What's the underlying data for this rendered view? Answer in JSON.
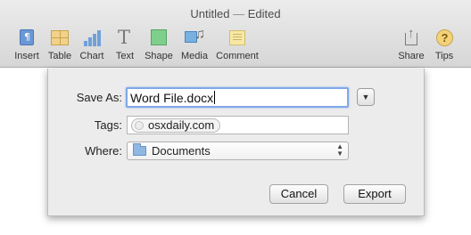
{
  "window": {
    "title_doc": "Untitled",
    "title_sep": "—",
    "title_status": "Edited"
  },
  "toolbar": {
    "items": [
      {
        "label": "Insert",
        "icon": "insert-icon"
      },
      {
        "label": "Table",
        "icon": "table-icon"
      },
      {
        "label": "Chart",
        "icon": "chart-icon"
      },
      {
        "label": "Text",
        "icon": "text-icon"
      },
      {
        "label": "Shape",
        "icon": "shape-icon"
      },
      {
        "label": "Media",
        "icon": "media-icon"
      },
      {
        "label": "Comment",
        "icon": "comment-icon"
      },
      {
        "label": "Share",
        "icon": "share-icon"
      },
      {
        "label": "Tips",
        "icon": "tips-icon"
      }
    ]
  },
  "save_dialog": {
    "save_as_label": "Save As:",
    "save_as_value": "Word File.docx",
    "tags_label": "Tags:",
    "tag_value": "osxdaily.com",
    "where_label": "Where:",
    "where_value": "Documents",
    "cancel_label": "Cancel",
    "export_label": "Export"
  },
  "colors": {
    "focus_ring": "#7fa8e6",
    "sheet_background": "#ececec"
  }
}
